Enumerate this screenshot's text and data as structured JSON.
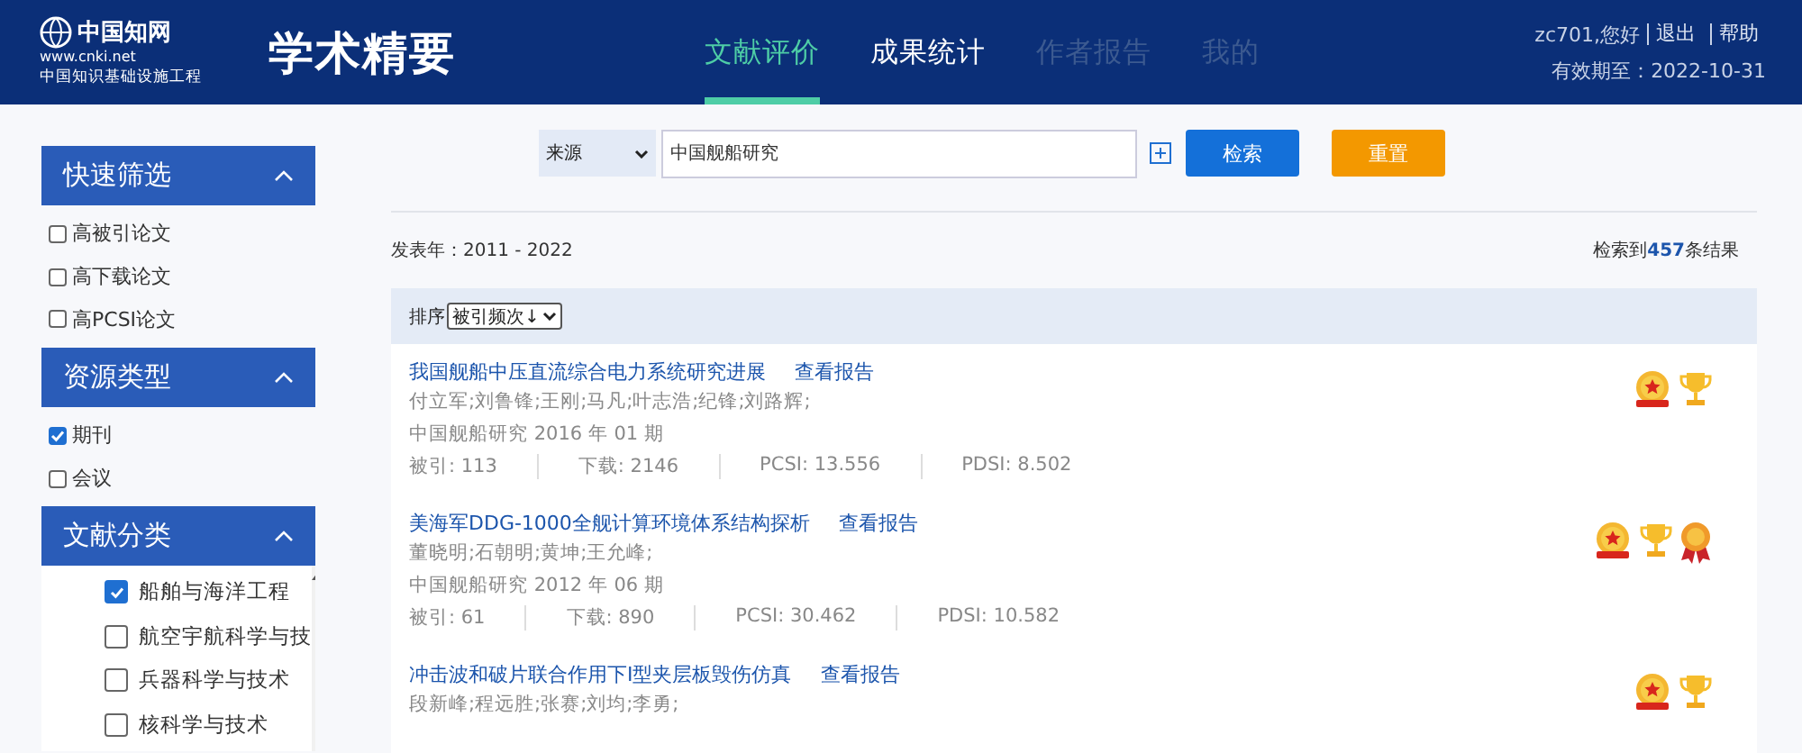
{
  "header": {
    "logo_text": "中国知网",
    "logo_url": "www.cnki.net",
    "logo_subtitle": "中国知识基础设施工程",
    "product": "学术精要",
    "nav": [
      {
        "label": "文献评价",
        "selected": true,
        "disabled": false
      },
      {
        "label": "成果统计",
        "selected": false,
        "disabled": false
      },
      {
        "label": "作者报告",
        "selected": false,
        "disabled": true
      },
      {
        "label": "我的",
        "selected": false,
        "disabled": true
      }
    ],
    "user": {
      "greeting": "zc701,您好",
      "links": [
        "退出",
        "帮助"
      ],
      "validity": "有效期至：2022-10-31"
    }
  },
  "sidebar": [
    {
      "title": "快速筛选",
      "expanded": true,
      "kind": "plain",
      "items": [
        {
          "label": "高被引论文",
          "checked": false
        },
        {
          "label": "高下载论文",
          "checked": false
        },
        {
          "label": "高PCSI论文",
          "checked": false
        }
      ]
    },
    {
      "title": "资源类型",
      "expanded": true,
      "kind": "plain",
      "items": [
        {
          "label": "期刊",
          "checked": true
        },
        {
          "label": "会议",
          "checked": false
        }
      ]
    },
    {
      "title": "文献分类",
      "expanded": true,
      "kind": "scroll",
      "items": [
        {
          "label": "船舶与海洋工程",
          "checked": true
        },
        {
          "label": "航空宇航科学与技",
          "checked": false
        },
        {
          "label": "兵器科学与技术",
          "checked": false
        },
        {
          "label": "核科学与技术",
          "checked": false
        }
      ]
    }
  ],
  "search": {
    "field": "来源",
    "value": "中国舰船研究",
    "buttons": [
      {
        "label": "检索",
        "kind": "primary"
      },
      {
        "label": "重置",
        "kind": "reset"
      }
    ]
  },
  "filter": {
    "years": "发表年：2011 - 2022",
    "count_prefix": "检索到",
    "count": "457",
    "count_suffix": "条结果"
  },
  "sort": {
    "label": "排序",
    "value": "被引频次↓"
  },
  "results": [
    {
      "title": "我国舰船中压直流综合电力系统研究进展",
      "report": "查看报告",
      "authors": "付立军;刘鲁锋;王刚;马凡;叶志浩;纪锋;刘路辉;",
      "source": "中国舰船研究 2016 年 01 期",
      "stats": [
        "被引: 113",
        "下载: 2146",
        "PCSI: 13.556",
        "PDSI: 8.502"
      ],
      "badges": [
        {
          "kind": "medal"
        },
        {
          "kind": "trophy"
        }
      ]
    },
    {
      "title": "美海军DDG-1000全舰计算环境体系结构探析",
      "report": "查看报告",
      "authors": "董晓明;石朝明;黄坤;王允峰;",
      "source": "中国舰船研究 2012 年 06 期",
      "stats": [
        "被引: 61",
        "下载: 890",
        "PCSI: 30.462",
        "PDSI: 10.582"
      ],
      "badges": [
        {
          "kind": "medal"
        },
        {
          "kind": "trophy"
        },
        {
          "kind": "rosette"
        }
      ]
    },
    {
      "title": "冲击波和破片联合作用下I型夹层板毁伤仿真",
      "report": "查看报告",
      "authors": "段新峰;程远胜;张赛;刘均;李勇;",
      "badges": [
        {
          "kind": "medal"
        },
        {
          "kind": "trophy"
        }
      ]
    }
  ]
}
